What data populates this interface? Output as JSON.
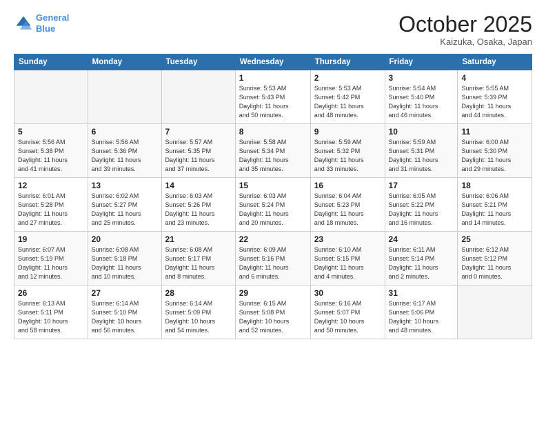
{
  "header": {
    "logo_line1": "General",
    "logo_line2": "Blue",
    "month": "October 2025",
    "location": "Kaizuka, Osaka, Japan"
  },
  "weekdays": [
    "Sunday",
    "Monday",
    "Tuesday",
    "Wednesday",
    "Thursday",
    "Friday",
    "Saturday"
  ],
  "weeks": [
    [
      {
        "day": "",
        "info": ""
      },
      {
        "day": "",
        "info": ""
      },
      {
        "day": "",
        "info": ""
      },
      {
        "day": "1",
        "info": "Sunrise: 5:53 AM\nSunset: 5:43 PM\nDaylight: 11 hours\nand 50 minutes."
      },
      {
        "day": "2",
        "info": "Sunrise: 5:53 AM\nSunset: 5:42 PM\nDaylight: 11 hours\nand 48 minutes."
      },
      {
        "day": "3",
        "info": "Sunrise: 5:54 AM\nSunset: 5:40 PM\nDaylight: 11 hours\nand 46 minutes."
      },
      {
        "day": "4",
        "info": "Sunrise: 5:55 AM\nSunset: 5:39 PM\nDaylight: 11 hours\nand 44 minutes."
      }
    ],
    [
      {
        "day": "5",
        "info": "Sunrise: 5:56 AM\nSunset: 5:38 PM\nDaylight: 11 hours\nand 41 minutes."
      },
      {
        "day": "6",
        "info": "Sunrise: 5:56 AM\nSunset: 5:36 PM\nDaylight: 11 hours\nand 39 minutes."
      },
      {
        "day": "7",
        "info": "Sunrise: 5:57 AM\nSunset: 5:35 PM\nDaylight: 11 hours\nand 37 minutes."
      },
      {
        "day": "8",
        "info": "Sunrise: 5:58 AM\nSunset: 5:34 PM\nDaylight: 11 hours\nand 35 minutes."
      },
      {
        "day": "9",
        "info": "Sunrise: 5:59 AM\nSunset: 5:32 PM\nDaylight: 11 hours\nand 33 minutes."
      },
      {
        "day": "10",
        "info": "Sunrise: 5:59 AM\nSunset: 5:31 PM\nDaylight: 11 hours\nand 31 minutes."
      },
      {
        "day": "11",
        "info": "Sunrise: 6:00 AM\nSunset: 5:30 PM\nDaylight: 11 hours\nand 29 minutes."
      }
    ],
    [
      {
        "day": "12",
        "info": "Sunrise: 6:01 AM\nSunset: 5:28 PM\nDaylight: 11 hours\nand 27 minutes."
      },
      {
        "day": "13",
        "info": "Sunrise: 6:02 AM\nSunset: 5:27 PM\nDaylight: 11 hours\nand 25 minutes."
      },
      {
        "day": "14",
        "info": "Sunrise: 6:03 AM\nSunset: 5:26 PM\nDaylight: 11 hours\nand 23 minutes."
      },
      {
        "day": "15",
        "info": "Sunrise: 6:03 AM\nSunset: 5:24 PM\nDaylight: 11 hours\nand 20 minutes."
      },
      {
        "day": "16",
        "info": "Sunrise: 6:04 AM\nSunset: 5:23 PM\nDaylight: 11 hours\nand 18 minutes."
      },
      {
        "day": "17",
        "info": "Sunrise: 6:05 AM\nSunset: 5:22 PM\nDaylight: 11 hours\nand 16 minutes."
      },
      {
        "day": "18",
        "info": "Sunrise: 6:06 AM\nSunset: 5:21 PM\nDaylight: 11 hours\nand 14 minutes."
      }
    ],
    [
      {
        "day": "19",
        "info": "Sunrise: 6:07 AM\nSunset: 5:19 PM\nDaylight: 11 hours\nand 12 minutes."
      },
      {
        "day": "20",
        "info": "Sunrise: 6:08 AM\nSunset: 5:18 PM\nDaylight: 11 hours\nand 10 minutes."
      },
      {
        "day": "21",
        "info": "Sunrise: 6:08 AM\nSunset: 5:17 PM\nDaylight: 11 hours\nand 8 minutes."
      },
      {
        "day": "22",
        "info": "Sunrise: 6:09 AM\nSunset: 5:16 PM\nDaylight: 11 hours\nand 6 minutes."
      },
      {
        "day": "23",
        "info": "Sunrise: 6:10 AM\nSunset: 5:15 PM\nDaylight: 11 hours\nand 4 minutes."
      },
      {
        "day": "24",
        "info": "Sunrise: 6:11 AM\nSunset: 5:14 PM\nDaylight: 11 hours\nand 2 minutes."
      },
      {
        "day": "25",
        "info": "Sunrise: 6:12 AM\nSunset: 5:12 PM\nDaylight: 11 hours\nand 0 minutes."
      }
    ],
    [
      {
        "day": "26",
        "info": "Sunrise: 6:13 AM\nSunset: 5:11 PM\nDaylight: 10 hours\nand 58 minutes."
      },
      {
        "day": "27",
        "info": "Sunrise: 6:14 AM\nSunset: 5:10 PM\nDaylight: 10 hours\nand 56 minutes."
      },
      {
        "day": "28",
        "info": "Sunrise: 6:14 AM\nSunset: 5:09 PM\nDaylight: 10 hours\nand 54 minutes."
      },
      {
        "day": "29",
        "info": "Sunrise: 6:15 AM\nSunset: 5:08 PM\nDaylight: 10 hours\nand 52 minutes."
      },
      {
        "day": "30",
        "info": "Sunrise: 6:16 AM\nSunset: 5:07 PM\nDaylight: 10 hours\nand 50 minutes."
      },
      {
        "day": "31",
        "info": "Sunrise: 6:17 AM\nSunset: 5:06 PM\nDaylight: 10 hours\nand 48 minutes."
      },
      {
        "day": "",
        "info": ""
      }
    ]
  ]
}
